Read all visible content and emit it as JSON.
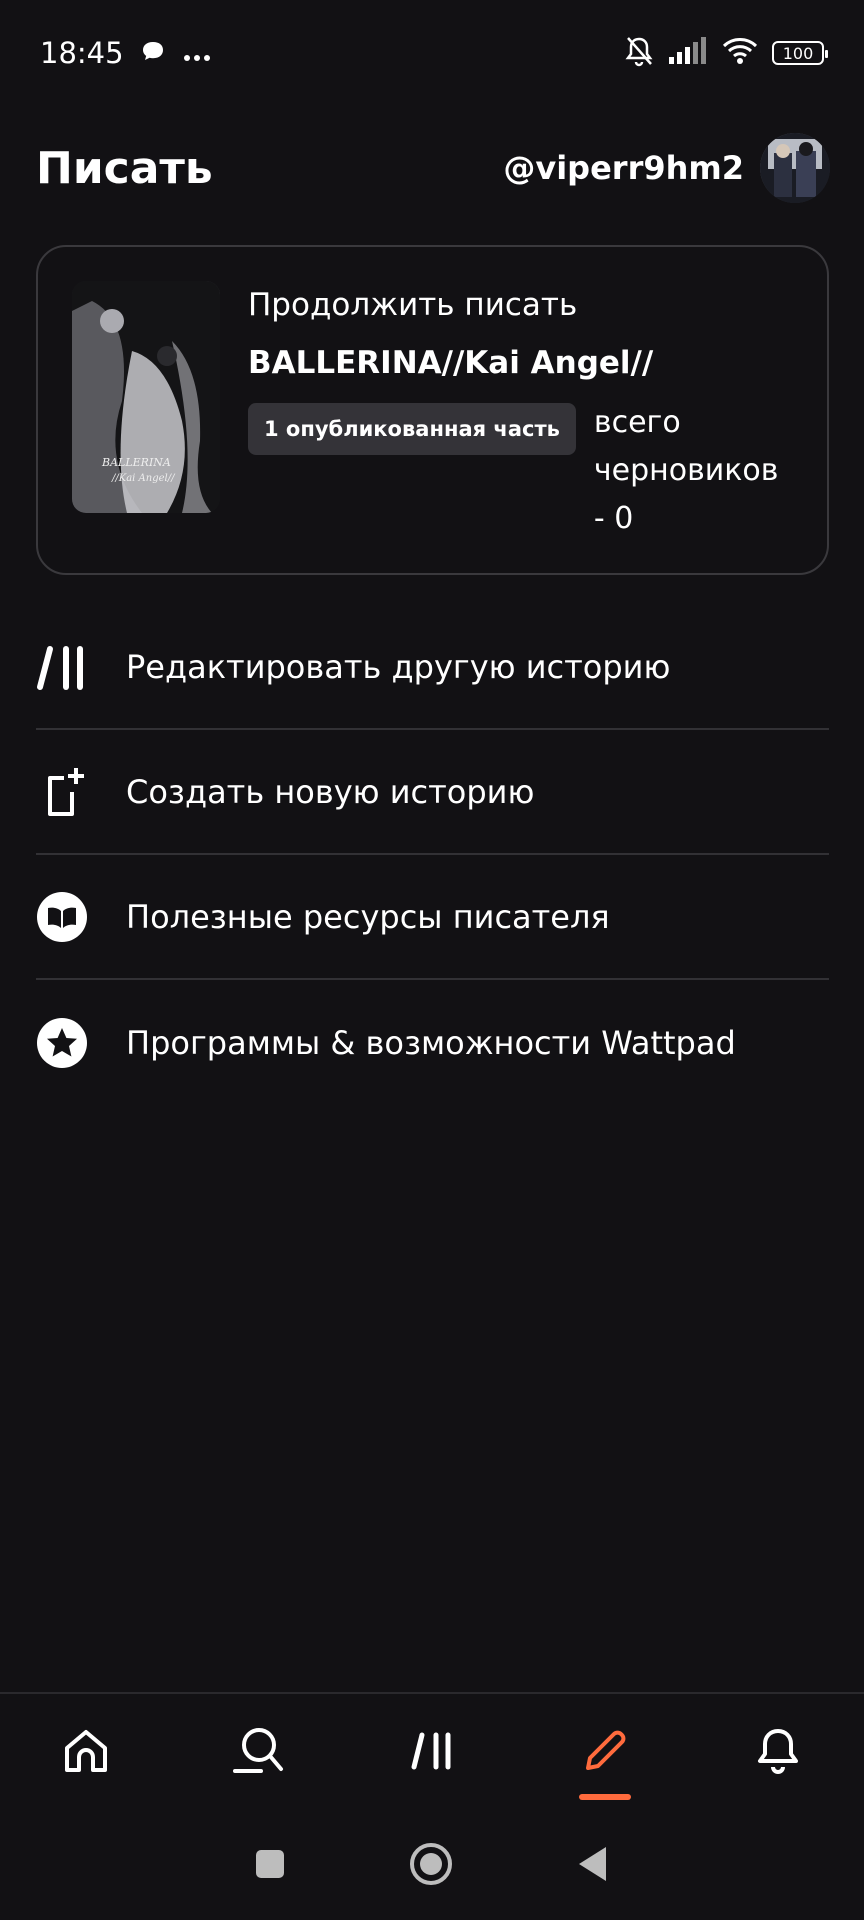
{
  "status_bar": {
    "time": "18:45",
    "icons": [
      "chat-bubble-icon",
      "more-dots-icon",
      "bell-off-icon",
      "signal-icon",
      "wifi-icon"
    ],
    "battery": "100"
  },
  "header": {
    "title": "Писать",
    "username": "@viperr9hm2"
  },
  "continue_card": {
    "label": "Продолжить писать",
    "story_title": "BALLERINA//Kai Angel//",
    "published_badge": "1 опубликованная часть",
    "drafts_text": "всего черновиков - 0"
  },
  "menu": {
    "items": [
      {
        "label": "Редактировать другую историю",
        "icon": "wattpad-logo-icon"
      },
      {
        "label": "Создать новую историю",
        "icon": "new-story-icon"
      },
      {
        "label": "Полезные ресурсы писателя",
        "icon": "book-icon"
      },
      {
        "label": "Программы & возможности Wattpad",
        "icon": "star-icon"
      }
    ]
  },
  "bottom_nav": {
    "items": [
      "home-icon",
      "search-icon",
      "library-icon",
      "write-icon",
      "notifications-icon"
    ],
    "active": "write-icon",
    "accent_color": "#ff6b3d"
  },
  "system_nav": [
    "recents-button",
    "home-button",
    "back-button"
  ],
  "colors": {
    "background": "#121114",
    "card_border": "#3a393d",
    "badge_bg": "#343338",
    "divider": "#323135"
  }
}
